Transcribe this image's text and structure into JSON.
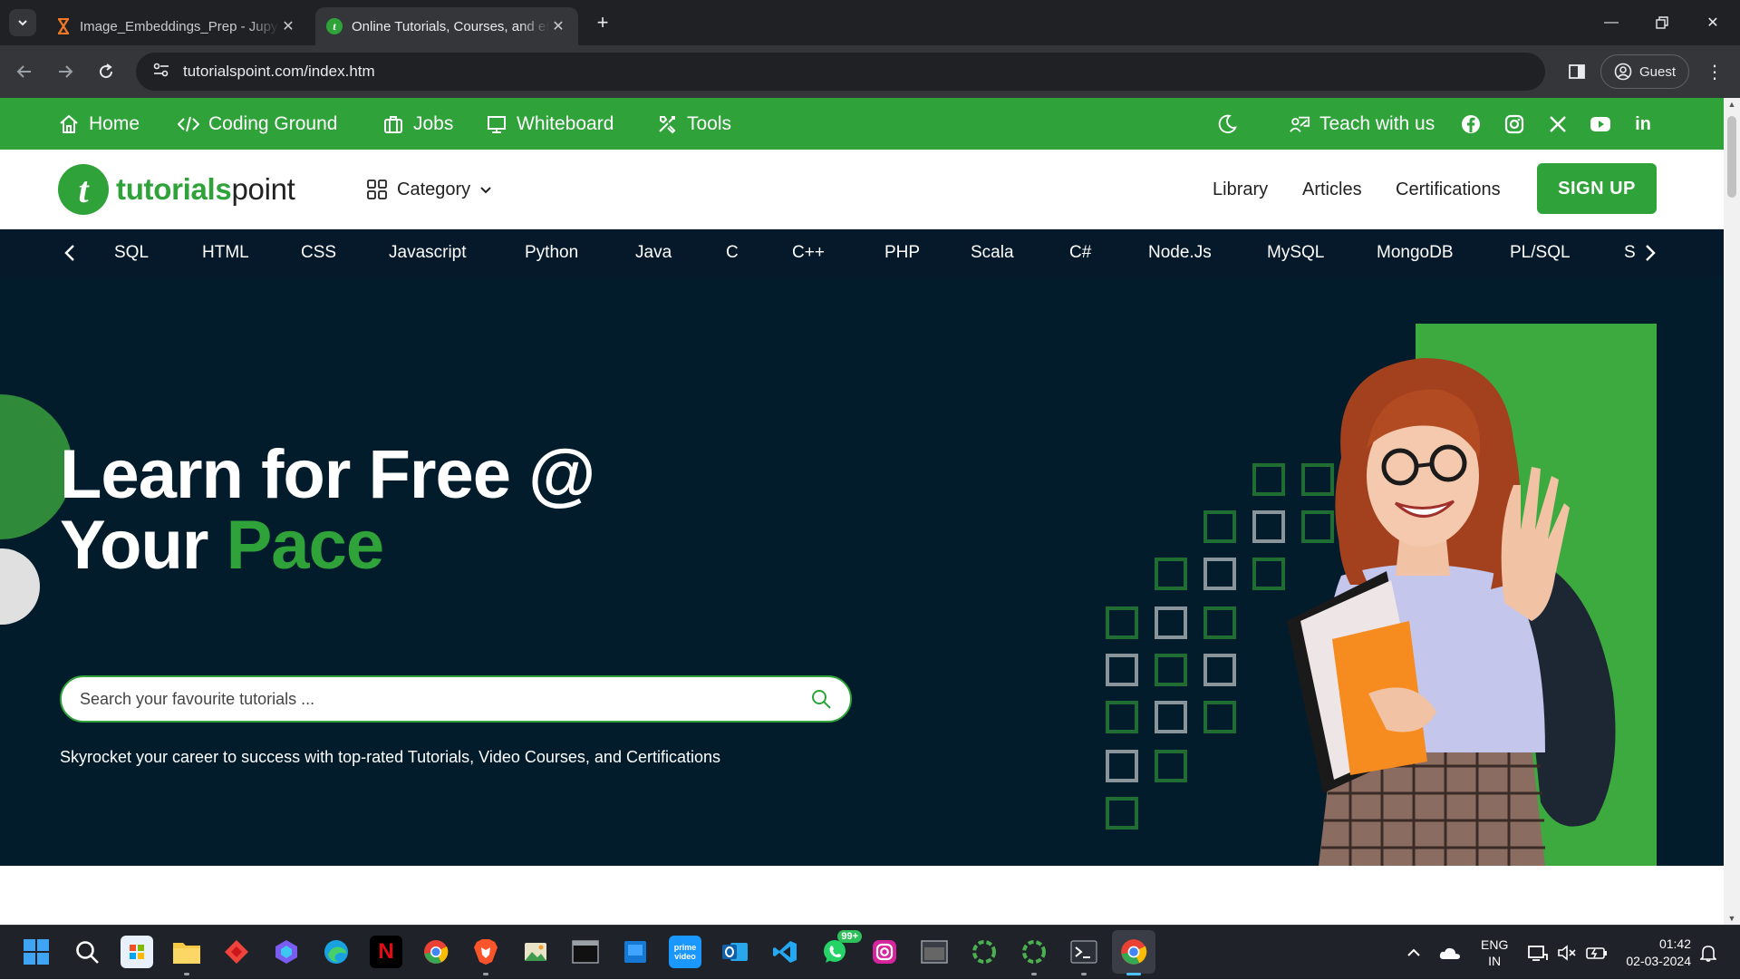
{
  "browser": {
    "tabs": [
      {
        "title": "Image_Embeddings_Prep - Jupyter",
        "active": false
      },
      {
        "title": "Online Tutorials, Courses, and eBooks",
        "active": true
      }
    ],
    "url": "tutorialspoint.com/index.htm",
    "profile_label": "Guest"
  },
  "topnav": {
    "items": [
      {
        "label": "Home",
        "icon": "home-icon"
      },
      {
        "label": "Coding Ground",
        "icon": "code-icon"
      },
      {
        "label": "Jobs",
        "icon": "briefcase-icon"
      },
      {
        "label": "Whiteboard",
        "icon": "whiteboard-icon"
      },
      {
        "label": "Tools",
        "icon": "tools-icon"
      }
    ],
    "teach_label": "Teach with us",
    "socials": [
      "facebook-icon",
      "instagram-icon",
      "x-icon",
      "youtube-icon",
      "linkedin-icon"
    ]
  },
  "header": {
    "logo_part1": "tutorials",
    "logo_part2": "point",
    "category_label": "Category",
    "links": [
      "Library",
      "Articles",
      "Certifications"
    ],
    "signup_label": "SIGN UP"
  },
  "languages": [
    "SQL",
    "HTML",
    "CSS",
    "Javascript",
    "Python",
    "Java",
    "C",
    "C++",
    "PHP",
    "Scala",
    "C#",
    "Node.Js",
    "MySQL",
    "MongoDB",
    "PL/SQL",
    "S"
  ],
  "hero": {
    "headline_line1": "Learn for Free @",
    "headline_line2_a": "Your ",
    "headline_line2_b": "Pace",
    "search_placeholder": "Search your favourite tutorials ...",
    "tagline": "Skyrocket your career to success with top-rated Tutorials, Video Courses, and Certifications"
  },
  "taskbar": {
    "whatsapp_badge": "99+",
    "lang_top": "ENG",
    "lang_bottom": "IN",
    "time": "01:42",
    "date": "02-03-2024"
  },
  "colors": {
    "brand_green": "#2fa33a",
    "hero_bg": "#021c2b",
    "langbar_bg": "#06192a"
  }
}
